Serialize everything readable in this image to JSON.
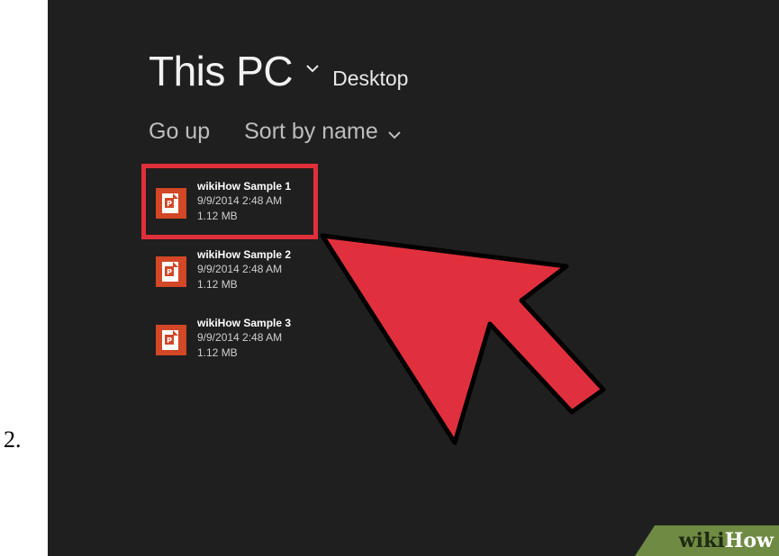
{
  "step_number": "2.",
  "header": {
    "title": "This PC",
    "location": "Desktop"
  },
  "command_bar": {
    "go_up": "Go up",
    "sort": "Sort by name"
  },
  "files": [
    {
      "name": "wikiHow Sample 1",
      "date": "9/9/2014 2:48 AM",
      "size": "1.12 MB",
      "icon": "powerpoint-file-icon"
    },
    {
      "name": "wikiHow Sample 2",
      "date": "9/9/2014 2:48 AM",
      "size": "1.12 MB",
      "icon": "powerpoint-file-icon"
    },
    {
      "name": "wikiHow Sample 3",
      "date": "9/9/2014 2:48 AM",
      "size": "1.12 MB",
      "icon": "powerpoint-file-icon"
    }
  ],
  "watermark": {
    "wiki": "wiki",
    "how": "How"
  },
  "colors": {
    "background": "#1f1f1f",
    "highlight": "#e02f3a",
    "file_icon": "#d24726",
    "watermark_green": "#6f8a43"
  }
}
